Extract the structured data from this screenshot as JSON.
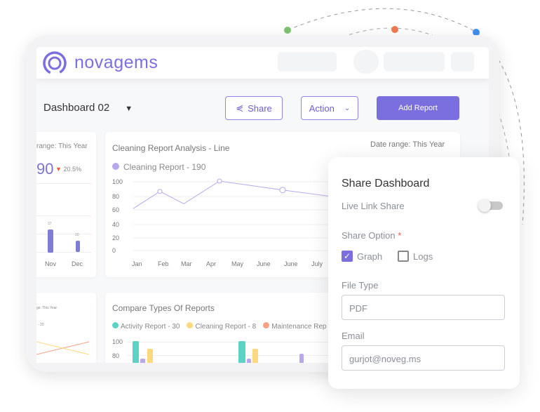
{
  "brand": {
    "name": "novagems",
    "color": "#7b6fe0"
  },
  "toolbar": {
    "dashboard_name": "Dashboard 02",
    "share_label": "Share",
    "action_label": "Action",
    "add_report_label": "Add Report"
  },
  "left_card": {
    "date_range": "range: This Year",
    "total": "90",
    "change": "20.5%",
    "months": [
      "Nov",
      "Dec"
    ],
    "bar_labels": [
      "37",
      "20"
    ],
    "bar_values": [
      37,
      20
    ]
  },
  "line_card": {
    "title": "Cleaning Report Analysis - Line",
    "date_range": "Date range: This Year"
  },
  "bottom_left_card": {
    "date_range": "ge: This Year",
    "legend": "- 20"
  },
  "bottom_card": {
    "title": "Compare Types Of Reports"
  },
  "chart_data": [
    {
      "type": "line",
      "title": "Cleaning Report Analysis - Line",
      "series": [
        {
          "name": "Cleaning Report - 190",
          "color": "#b8a7ea",
          "values": [
            60,
            85,
            67,
            100,
            87,
            78
          ]
        }
      ],
      "x_labels": [
        "Jan",
        "Feb",
        "Mar",
        "Apr",
        "May",
        "June",
        "June",
        "July"
      ],
      "y_ticks": [
        "100",
        "80",
        "60",
        "40",
        "20",
        "0"
      ],
      "ylim": [
        0,
        100
      ]
    },
    {
      "type": "bar",
      "title": "Compare Types Of Reports",
      "legend": [
        {
          "name": "Activity Report - 30",
          "color": "#5dd3c6"
        },
        {
          "name": "Cleaning Report - 8",
          "color": "#fcd97e"
        },
        {
          "name": "Maintenance Rep",
          "color": "#f9a187"
        }
      ],
      "y_ticks": [
        "100",
        "80"
      ],
      "bar_color_other": "#b8a7ea"
    }
  ],
  "share_panel": {
    "title": "Share Dashboard",
    "live_link_label": "Live Link Share",
    "live_link_on": false,
    "share_option_label": "Share Option",
    "required_mark": "*",
    "options": [
      {
        "label": "Graph",
        "checked": true
      },
      {
        "label": "Logs",
        "checked": false
      }
    ],
    "file_type_label": "File Type",
    "file_type_value": "PDF",
    "email_label": "Email",
    "email_value": "gurjot@noveg.ms"
  }
}
